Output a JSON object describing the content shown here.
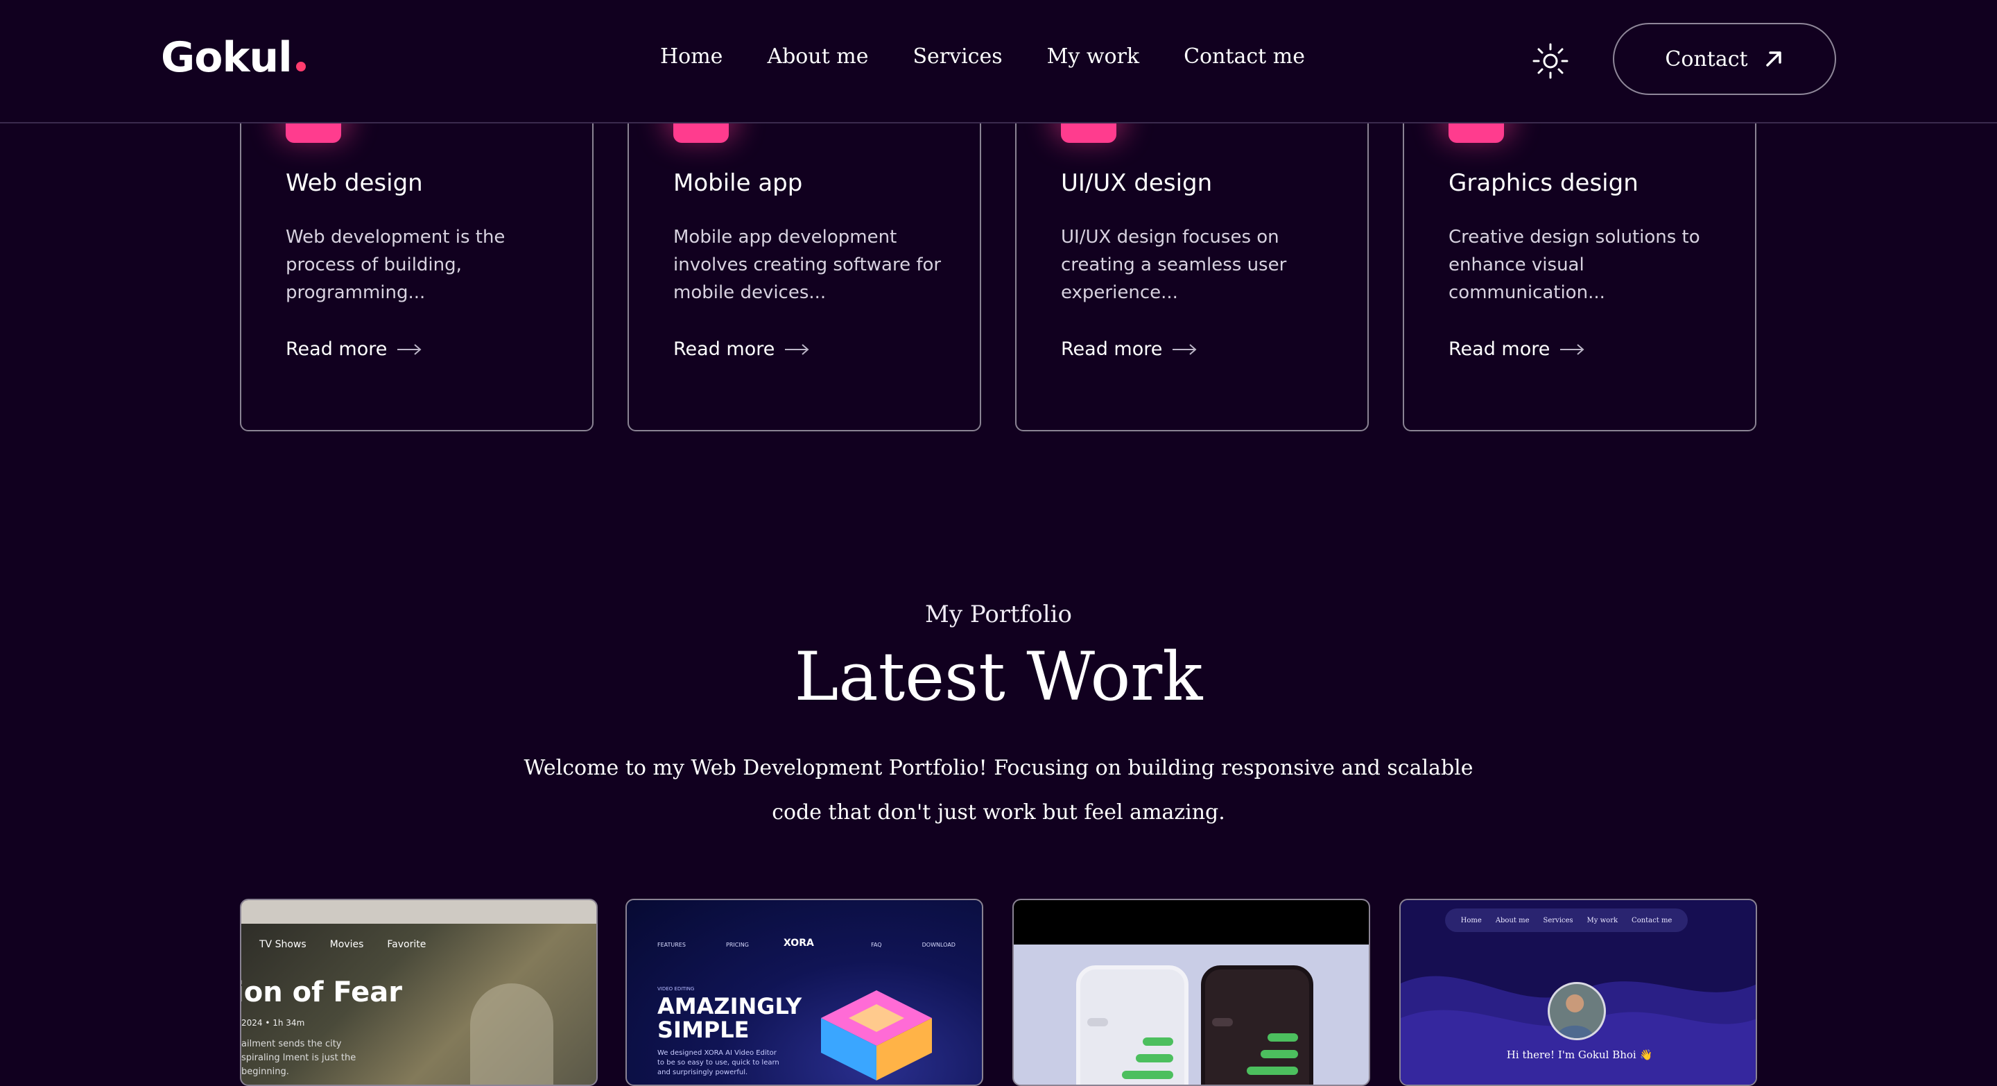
{
  "header": {
    "logo": "Gokul",
    "nav": [
      "Home",
      "About me",
      "Services",
      "My work",
      "Contact me"
    ],
    "contact_label": "Contact",
    "theme_icon": "sun-icon",
    "accent_color": "#ff3c6e"
  },
  "services": [
    {
      "title": "Web design",
      "description": "Web development is the process of building, programming...",
      "link": "Read more"
    },
    {
      "title": "Mobile app",
      "description": "Mobile app development involves creating software for mobile devices...",
      "link": "Read more"
    },
    {
      "title": "UI/UX design",
      "description": "UI/UX design focuses on creating a seamless user experience...",
      "link": "Read more"
    },
    {
      "title": "Graphics design",
      "description": "Creative design solutions to enhance visual communication...",
      "link": "Read more"
    }
  ],
  "portfolio": {
    "subtitle": "My Portfolio",
    "title": "Latest Work",
    "description": "Welcome to my Web Development Portfolio! Focusing on building responsive and scalable code that don't just work but feel amazing."
  },
  "works": {
    "movie": {
      "menu": [
        "TV Shows",
        "Movies",
        "Favorite"
      ],
      "title": "ion of Fear",
      "meta": "2024  •  1h 34m",
      "description": "ailment sends the city spiraling lment is just the beginning."
    },
    "xora": {
      "nav": [
        "FEATURES",
        "PRICING",
        "FAQ",
        "DOWNLOAD"
      ],
      "brand": "XORA",
      "edition": "VIDEO EDITING",
      "headline": "AMAZINGLY SIMPLE",
      "text": "We designed XORA AI Video Editor to be so easy to use, quick to learn and surprisingly powerful."
    },
    "portfolio_site": {
      "nav": [
        "Home",
        "About me",
        "Services",
        "My work",
        "Contact me"
      ],
      "greeting": "Hi there! I'm Gokul Bhoi 👋"
    }
  }
}
